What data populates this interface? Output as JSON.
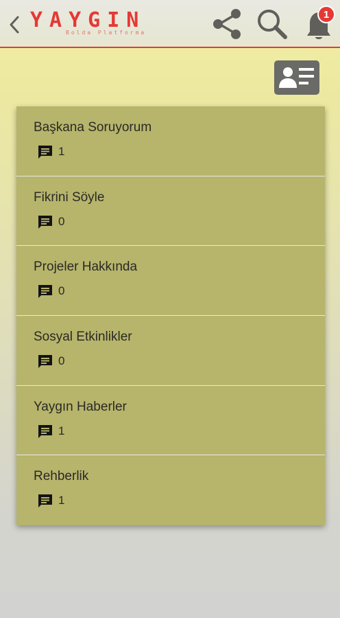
{
  "app": {
    "logo_text": "YAYGIN",
    "logo_subtitle": "Bolda Platforma",
    "notification_count": "1",
    "colors": {
      "accent": "#e53935",
      "card": "#b7b46c",
      "icon": "#5f5f5b"
    }
  },
  "topics": [
    {
      "title": "Başkana Soruyorum",
      "count": "1"
    },
    {
      "title": "Fikrini Söyle",
      "count": "0"
    },
    {
      "title": "Projeler Hakkında",
      "count": "0"
    },
    {
      "title": "Sosyal Etkinlikler",
      "count": "0"
    },
    {
      "title": "Yaygın Haberler",
      "count": "1"
    },
    {
      "title": "Rehberlik",
      "count": "1"
    }
  ]
}
